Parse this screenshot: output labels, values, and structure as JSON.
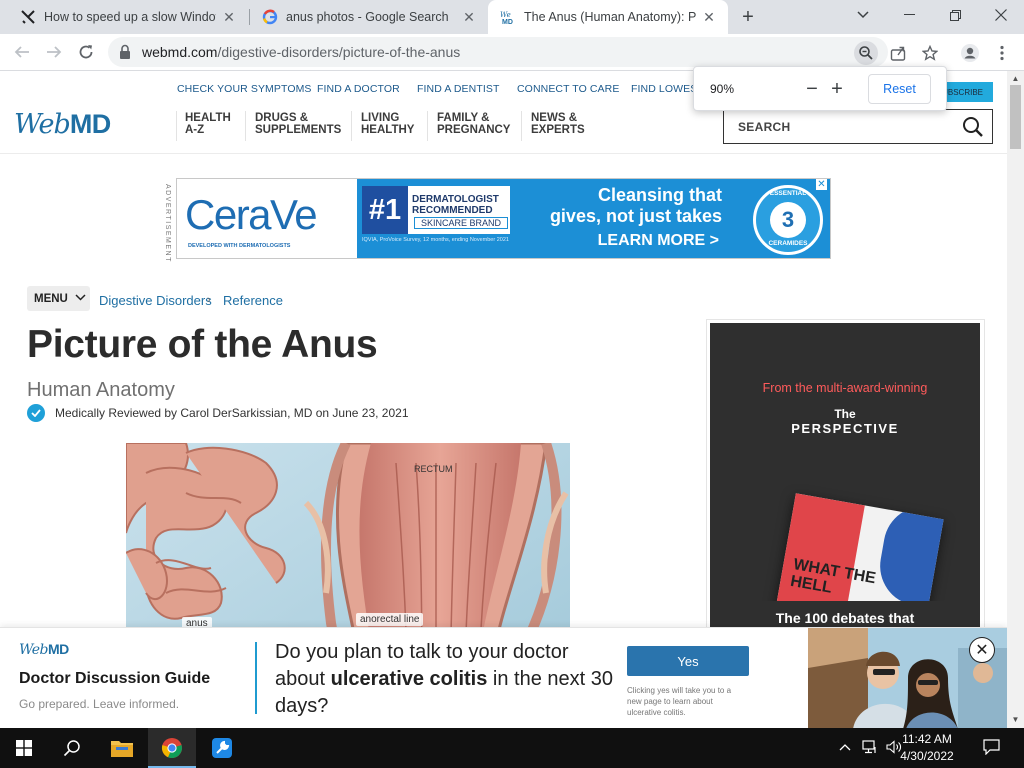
{
  "browser": {
    "tabs": [
      {
        "title": "How to speed up a slow Window",
        "active": false
      },
      {
        "title": "anus photos - Google Search",
        "active": false
      },
      {
        "title": "The Anus (Human Anatomy): Pict",
        "active": true
      }
    ],
    "url_host": "webmd.com",
    "url_path": "/digestive-disorders/picture-of-the-anus",
    "zoom": {
      "percent": "90%",
      "minus": "−",
      "plus": "+",
      "reset_label": "Reset"
    }
  },
  "site": {
    "logo_a": "Web",
    "logo_b": "MD",
    "top_links": [
      "CHECK YOUR SYMPTOMS",
      "FIND A DOCTOR",
      "FIND A DENTIST",
      "CONNECT TO CARE",
      "FIND LOWEST D"
    ],
    "subscribe": "SUBSCRIBE",
    "main_nav": [
      {
        "l1": "HEALTH",
        "l2": "A-Z"
      },
      {
        "l1": "DRUGS &",
        "l2": "SUPPLEMENTS"
      },
      {
        "l1": "LIVING",
        "l2": "HEALTHY"
      },
      {
        "l1": "FAMILY &",
        "l2": "PREGNANCY"
      },
      {
        "l1": "NEWS &",
        "l2": "EXPERTS"
      }
    ],
    "search_placeholder": "SEARCH"
  },
  "ad_banner": {
    "side_label": "ADVERTISEMENT",
    "brand": "CeraVe",
    "brand_sub": "DEVELOPED WITH DERMATOLOGISTS",
    "badge_num": "#1",
    "badge_l1": "DERMATOLOGIST",
    "badge_l2": "RECOMMENDED",
    "badge_l3": "SKINCARE BRAND",
    "fine_print": "IQVIA, ProVoice Survey, 12 months, ending November 2021",
    "headline_1": "Cleansing that",
    "headline_2": "gives, not just takes",
    "cta": "LEARN MORE >",
    "seal_top": "ESSENTIAL",
    "seal_num": "3",
    "seal_bottom": "CERAMIDES"
  },
  "article": {
    "menu_label": "MENU",
    "breadcrumb": [
      "Digestive Disorders",
      "Reference"
    ],
    "title": "Picture of the Anus",
    "subtitle": "Human Anatomy",
    "reviewed": "Medically Reviewed by Carol DerSarkissian, MD on June 23, 2021",
    "image_labels": {
      "rectum": "RECTUM",
      "anus": "anus",
      "anorectal": "anorectal line"
    }
  },
  "side_ad": {
    "line1": "From the multi-award-winning",
    "line2": "The",
    "line3": "PERSPECTIVE",
    "book_text_1": "WHAT THE",
    "book_text_2": "HELL",
    "tagline": "The 100 debates that"
  },
  "sticky": {
    "logo_a": "Web",
    "logo_b": "MD",
    "guide_title": "Doctor Discussion Guide",
    "guide_sub": "Go prepared. Leave informed.",
    "question_pre": "Do you plan to talk to your doctor about ",
    "question_bold": "ulcerative colitis",
    "question_post": " in the next 30 days?",
    "yes_label": "Yes",
    "fine_print": "Clicking yes will take you to a new page to learn about ulcerative colitis."
  },
  "taskbar": {
    "time": "11:42 AM",
    "date": "4/30/2022"
  },
  "colors": {
    "webmd_blue": "#1f6fa3",
    "link_blue": "#1d5a8c",
    "cerave_blue": "#1c8fd6",
    "yes_button": "#2a74ad",
    "zoom_reset": "#1a73e8"
  }
}
